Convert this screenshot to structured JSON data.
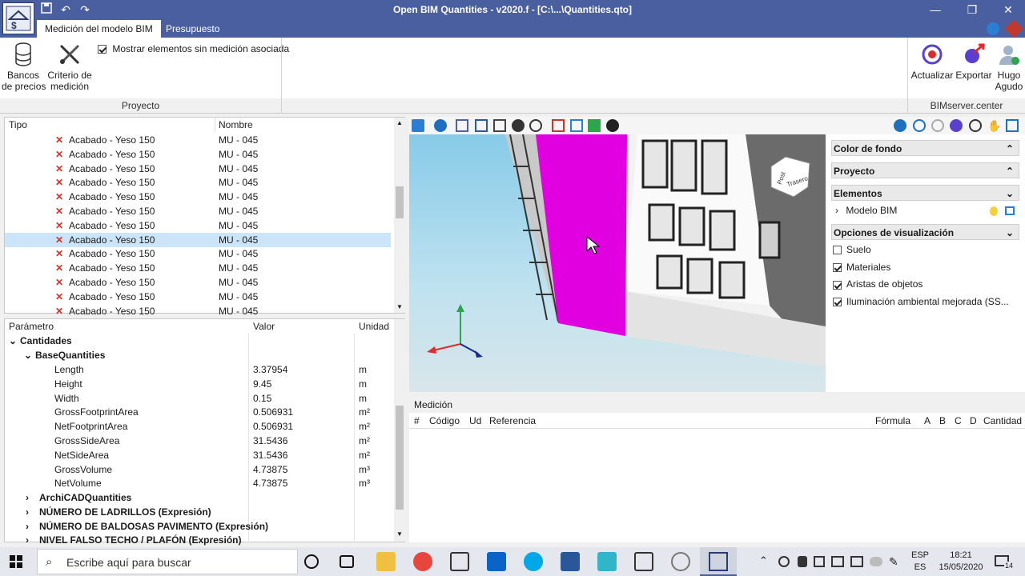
{
  "window": {
    "title": "Open BIM Quantities - v2020.f - [C:\\...\\Quantities.qto]"
  },
  "tabs": [
    "Medición del modelo BIM",
    "Presupuesto"
  ],
  "ribbon": {
    "bancos": "Bancos\nde precios",
    "criterio": "Criterio de\nmedición",
    "checkbox_label": "Mostrar elementos sin medición asociada",
    "group_proyecto": "Proyecto",
    "actualizar": "Actualizar",
    "exportar": "Exportar",
    "user": "Hugo\nAgudo",
    "group_server": "BIMserver.center"
  },
  "elements": {
    "col_tipo": "Tipo",
    "col_nombre": "Nombre",
    "rows": [
      {
        "tipo": "Acabado - Yeso 150",
        "nombre": "MU - 045"
      },
      {
        "tipo": "Acabado - Yeso 150",
        "nombre": "MU - 045"
      },
      {
        "tipo": "Acabado - Yeso 150",
        "nombre": "MU - 045"
      },
      {
        "tipo": "Acabado - Yeso 150",
        "nombre": "MU - 045"
      },
      {
        "tipo": "Acabado - Yeso 150",
        "nombre": "MU - 045"
      },
      {
        "tipo": "Acabado - Yeso 150",
        "nombre": "MU - 045"
      },
      {
        "tipo": "Acabado - Yeso 150",
        "nombre": "MU - 045"
      },
      {
        "tipo": "Acabado - Yeso 150",
        "nombre": "MU - 045"
      },
      {
        "tipo": "Acabado - Yeso 150",
        "nombre": "MU - 045"
      },
      {
        "tipo": "Acabado - Yeso 150",
        "nombre": "MU - 045"
      },
      {
        "tipo": "Acabado - Yeso 150",
        "nombre": "MU - 045"
      },
      {
        "tipo": "Acabado - Yeso 150",
        "nombre": "MU - 045"
      },
      {
        "tipo": "Acabado - Yeso 150",
        "nombre": "MU - 045"
      }
    ]
  },
  "params": {
    "col_param": "Parámetro",
    "col_valor": "Valor",
    "col_unidad": "Unidad",
    "cantidades": "Cantidades",
    "base": "BaseQuantities",
    "rows": [
      {
        "name": "Length",
        "value": "3.37954",
        "unit": "m"
      },
      {
        "name": "Height",
        "value": "9.45",
        "unit": "m"
      },
      {
        "name": "Width",
        "value": "0.15",
        "unit": "m"
      },
      {
        "name": "GrossFootprintArea",
        "value": "0.506931",
        "unit": "m²"
      },
      {
        "name": "NetFootprintArea",
        "value": "0.506931",
        "unit": "m²"
      },
      {
        "name": "GrossSideArea",
        "value": "31.5436",
        "unit": "m²"
      },
      {
        "name": "NetSideArea",
        "value": "31.5436",
        "unit": "m²"
      },
      {
        "name": "GrossVolume",
        "value": "4.73875",
        "unit": "m³"
      },
      {
        "name": "NetVolume",
        "value": "4.73875",
        "unit": "m³"
      }
    ],
    "groups": [
      "ArchiCADQuantities",
      "NÚMERO DE LADRILLOS (Expresión)",
      "NÚMERO DE BALDOSAS PAVIMENTO (Expresión)",
      "NIVEL FALSO TECHO / PLAFÓN (Expresión)"
    ]
  },
  "sidepanel": {
    "color_fondo": "Color de fondo",
    "proyecto": "Proyecto",
    "elementos": "Elementos",
    "modelo": "Modelo BIM",
    "opciones": "Opciones de visualización",
    "options": [
      {
        "label": "Suelo",
        "checked": false
      },
      {
        "label": "Materiales",
        "checked": true
      },
      {
        "label": "Aristas de objetos",
        "checked": true
      },
      {
        "label": "Iluminación ambiental mejorada (SS...",
        "checked": true
      }
    ]
  },
  "viewcube": {
    "front": "Post",
    "side": "Trasero"
  },
  "medicion": {
    "title": "Medición",
    "cols": [
      "#",
      "Código",
      "Ud",
      "Referencia",
      "Fórmula",
      "A",
      "B",
      "C",
      "D",
      "Cantidad"
    ]
  },
  "taskbar": {
    "search": "Escribe aquí para buscar",
    "lang1": "ESP",
    "lang2": "ES",
    "time": "18:21",
    "date": "15/05/2020",
    "notif": "14"
  },
  "colors": {
    "titlebar": "#4a5fa0",
    "highlight": "#e000e0",
    "selected_row": "#cce4f7"
  }
}
